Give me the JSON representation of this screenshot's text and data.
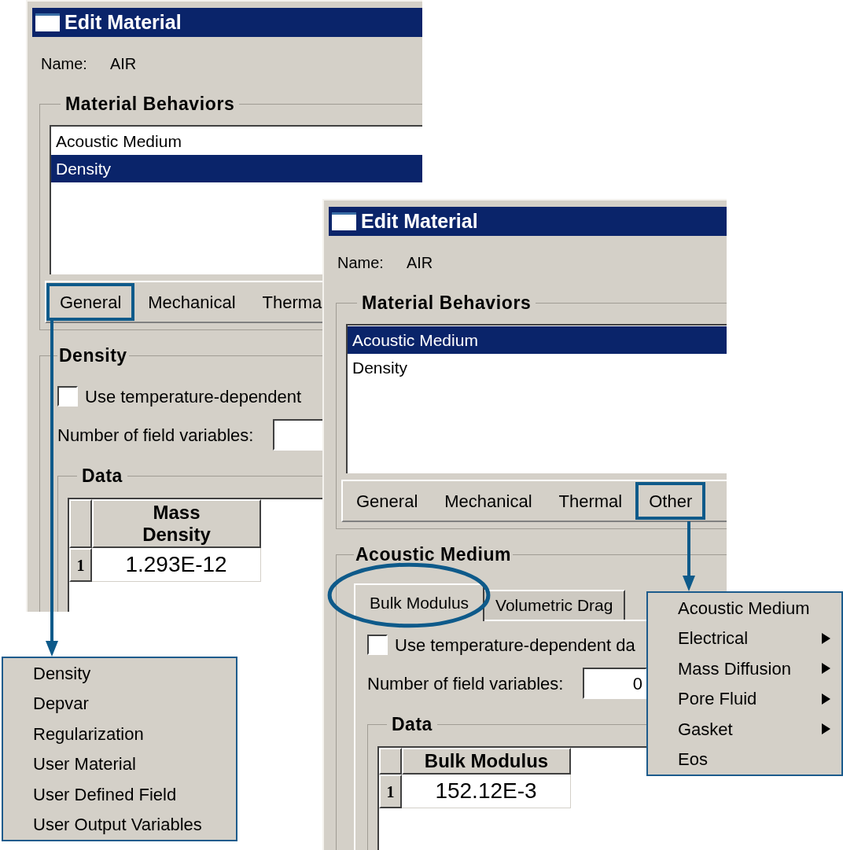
{
  "dialogs": [
    {
      "title": "Edit Material",
      "name_label": "Name:",
      "name_value": "AIR",
      "behaviors": {
        "title": "Material Behaviors",
        "items": [
          {
            "label": "Acoustic Medium",
            "selected": false
          },
          {
            "label": "Density",
            "selected": true
          }
        ]
      },
      "menu_buttons": [
        {
          "label": "General",
          "highlighted": true
        },
        {
          "label": "Mechanical",
          "highlighted": false
        },
        {
          "label": "Therma",
          "highlighted": false
        }
      ],
      "editor": {
        "title": "Density",
        "checkbox": {
          "label": "Use temperature-dependent",
          "checked": false
        },
        "field": {
          "label": "Number of field variables:"
        },
        "data": {
          "title": "Data",
          "column": "Mass\nDensity",
          "rows": [
            {
              "number": "1",
              "value": "1.293E-12"
            }
          ]
        }
      }
    },
    {
      "title": "Edit Material",
      "name_label": "Name:",
      "name_value": "AIR",
      "behaviors": {
        "title": "Material Behaviors",
        "items": [
          {
            "label": "Acoustic Medium",
            "selected": true
          },
          {
            "label": "Density",
            "selected": false
          }
        ]
      },
      "menu_buttons": [
        {
          "label": "General",
          "highlighted": false
        },
        {
          "label": "Mechanical",
          "highlighted": false
        },
        {
          "label": "Thermal",
          "highlighted": false
        },
        {
          "label": "Other",
          "highlighted": true
        }
      ],
      "editor": {
        "title": "Acoustic Medium",
        "tabs": [
          {
            "label": "Bulk Modulus",
            "selected": true,
            "circled": true
          },
          {
            "label": "Volumetric Drag",
            "selected": false,
            "circled": false
          }
        ],
        "checkbox": {
          "label": "Use temperature-dependent da",
          "checked": false
        },
        "field": {
          "label": "Number of field variables:",
          "value": "0"
        },
        "data": {
          "title": "Data",
          "column": "Bulk Modulus",
          "rows": [
            {
              "number": "1",
              "value": "152.12E-3"
            }
          ]
        }
      }
    }
  ],
  "menus": [
    {
      "items": [
        {
          "label": "Density",
          "submenu": false
        },
        {
          "label": "Depvar",
          "submenu": false
        },
        {
          "label": "Regularization",
          "submenu": false
        },
        {
          "label": "User Material",
          "submenu": false
        },
        {
          "label": "User Defined Field",
          "submenu": false
        },
        {
          "label": "User Output Variables",
          "submenu": false
        }
      ]
    },
    {
      "items": [
        {
          "label": "Acoustic Medium",
          "submenu": false
        },
        {
          "label": "Electrical",
          "submenu": true
        },
        {
          "label": "Mass Diffusion",
          "submenu": true
        },
        {
          "label": "Pore Fluid",
          "submenu": true
        },
        {
          "label": "Gasket",
          "submenu": true
        },
        {
          "label": "Eos",
          "submenu": false
        }
      ]
    }
  ]
}
